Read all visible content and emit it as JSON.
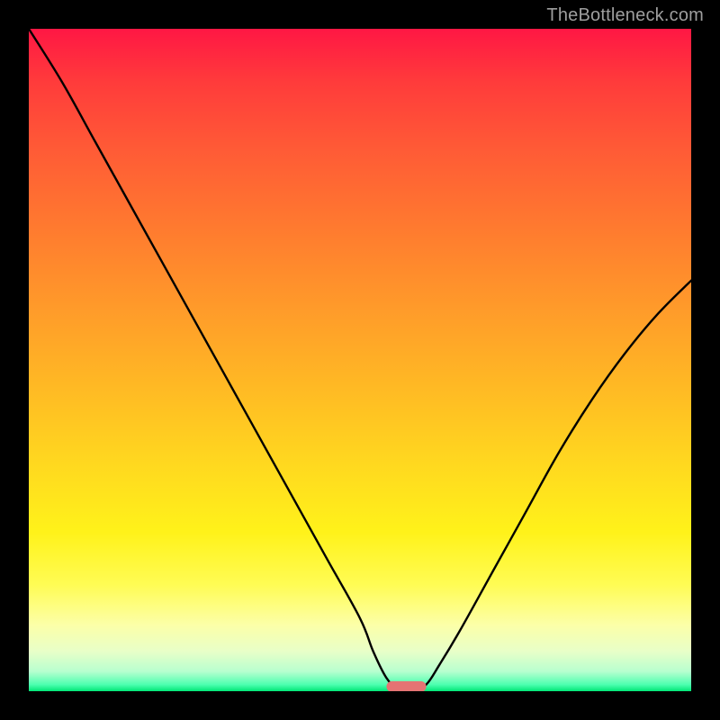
{
  "watermark": "TheBottleneck.com",
  "chart_data": {
    "type": "line",
    "title": "",
    "xlabel": "",
    "ylabel": "",
    "xlim": [
      0,
      100
    ],
    "ylim": [
      0,
      100
    ],
    "series": [
      {
        "name": "bottleneck-curve",
        "x": [
          0,
          5,
          10,
          15,
          20,
          25,
          30,
          35,
          40,
          45,
          50,
          52,
          54,
          56,
          58,
          60,
          62,
          65,
          70,
          75,
          80,
          85,
          90,
          95,
          100
        ],
        "y": [
          100,
          92,
          83,
          74,
          65,
          56,
          47,
          38,
          29,
          20,
          11,
          6,
          2,
          0,
          0,
          1,
          4,
          9,
          18,
          27,
          36,
          44,
          51,
          57,
          62
        ]
      }
    ],
    "marker": {
      "name": "optimal-range",
      "x_center": 57,
      "y": 0.7,
      "width": 6,
      "color": "#e57373"
    },
    "background_gradient": {
      "top": "#ff1744",
      "bottom": "#00e676"
    }
  }
}
